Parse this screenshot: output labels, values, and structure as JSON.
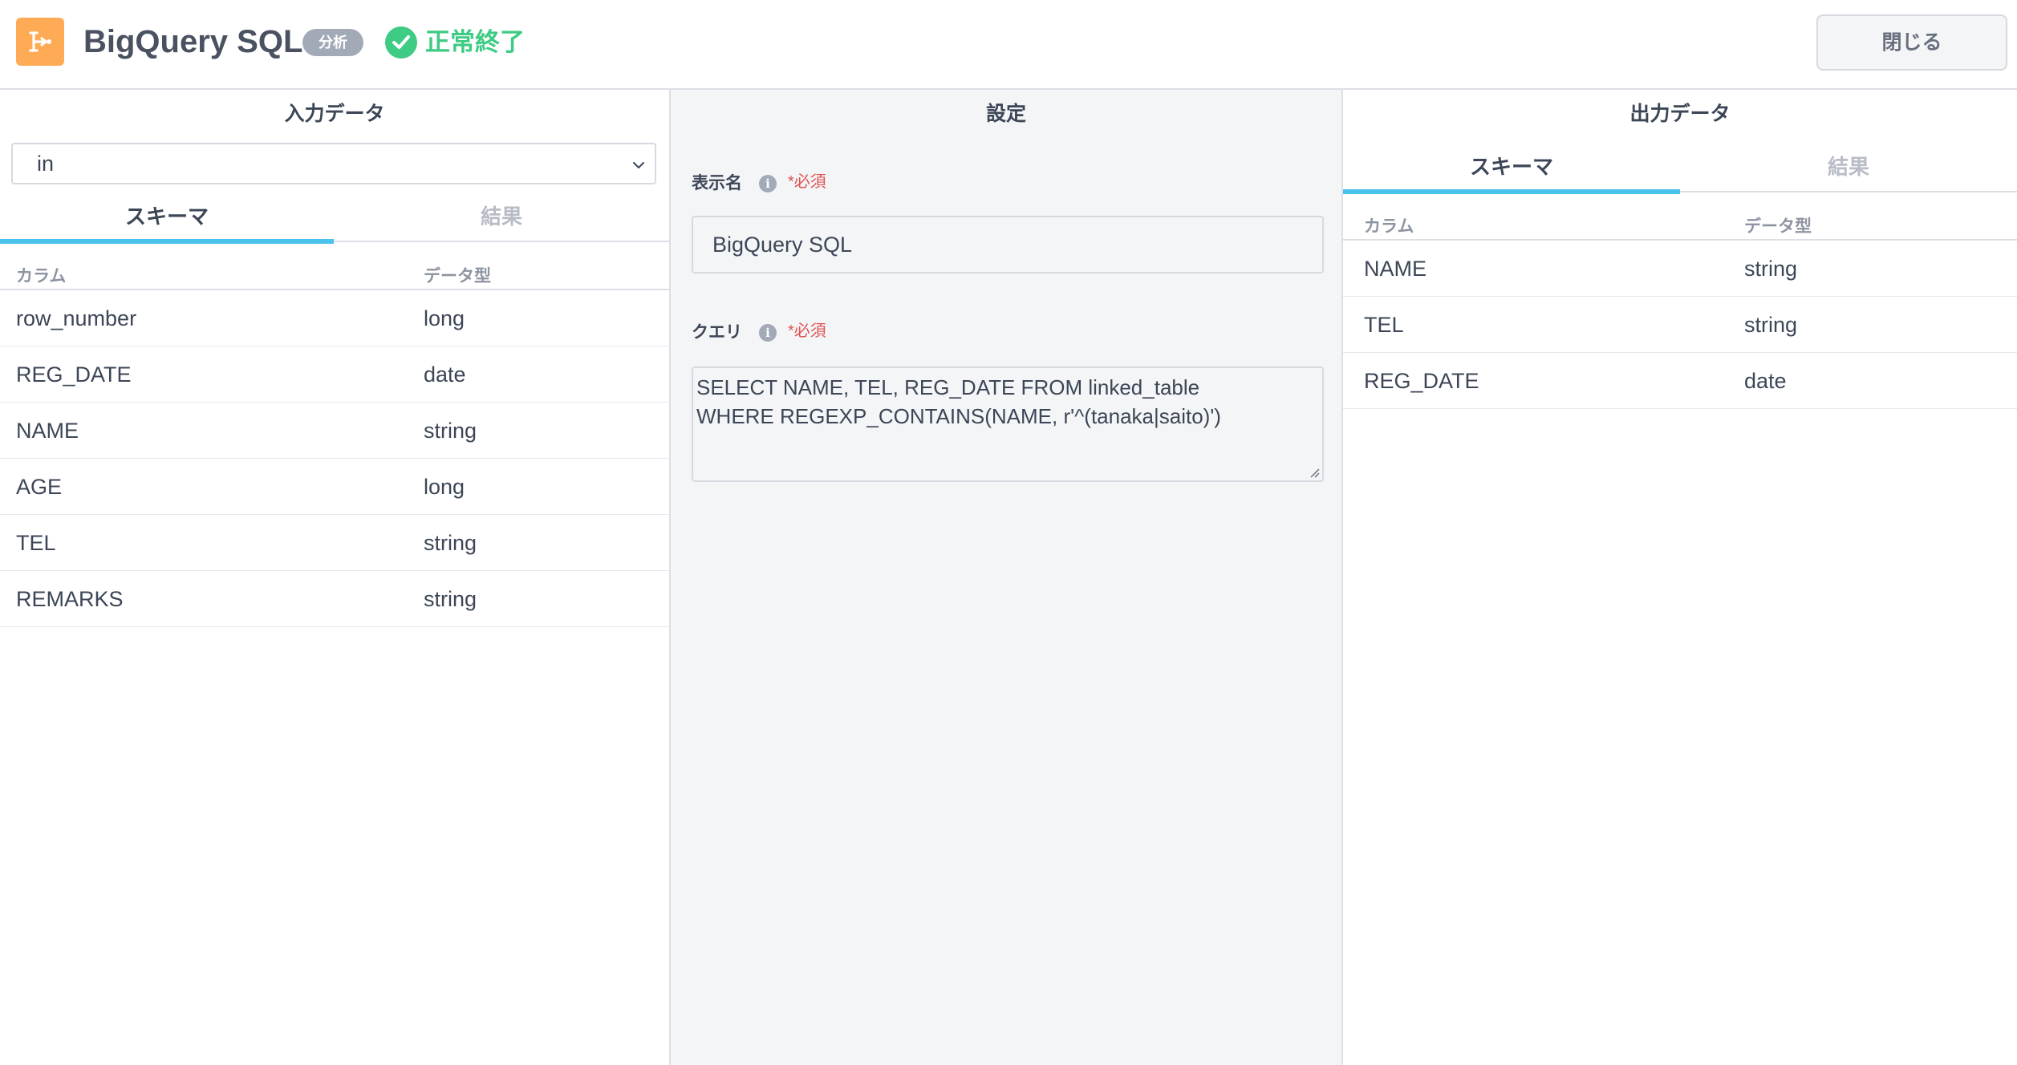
{
  "header": {
    "title": "BigQuery SQL",
    "badge": "分析",
    "status": "正常終了",
    "close_label": "閉じる",
    "app_icon": "flow-node-icon",
    "status_icon": "check-circle-icon"
  },
  "colors": {
    "accent_orange": "#ffaa55",
    "success_green": "#3ecb83",
    "tab_underline": "#4ac3ec",
    "required_red": "#e05252",
    "badge_gray": "#a3aab7"
  },
  "input_panel": {
    "title": "入力データ",
    "select_value": "in",
    "tabs": [
      {
        "label": "スキーマ",
        "active": true
      },
      {
        "label": "結果",
        "active": false
      }
    ],
    "columns": [
      "カラム",
      "データ型"
    ],
    "rows": [
      [
        "row_number",
        "long"
      ],
      [
        "REG_DATE",
        "date"
      ],
      [
        "NAME",
        "string"
      ],
      [
        "AGE",
        "long"
      ],
      [
        "TEL",
        "string"
      ],
      [
        "REMARKS",
        "string"
      ]
    ]
  },
  "settings_panel": {
    "title": "設定",
    "display_name_label": "表示名",
    "display_name_value": "BigQuery SQL",
    "query_label": "クエリ",
    "required_label": "*必須",
    "info_glyph": "i",
    "query_lines": [
      "SELECT NAME, TEL, REG_DATE FROM linked_table",
      "WHERE REGEXP_CONTAINS(NAME, r'^(tanaka|saito)')"
    ]
  },
  "output_panel": {
    "title": "出力データ",
    "tabs": [
      {
        "label": "スキーマ",
        "active": true
      },
      {
        "label": "結果",
        "active": false
      }
    ],
    "columns": [
      "カラム",
      "データ型"
    ],
    "rows": [
      [
        "NAME",
        "string"
      ],
      [
        "TEL",
        "string"
      ],
      [
        "REG_DATE",
        "date"
      ]
    ]
  }
}
